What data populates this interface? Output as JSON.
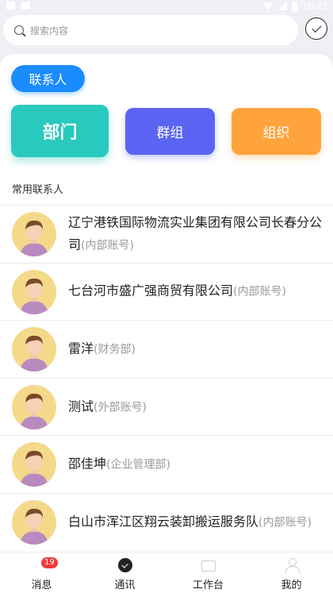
{
  "status_bar": {
    "time": "10:21"
  },
  "search": {
    "placeholder": "搜索内容"
  },
  "contacts_pill": "联系人",
  "categories": {
    "dept": "部门",
    "group": "群组",
    "org": "组织"
  },
  "section_title": "常用联系人",
  "contacts": [
    {
      "name": "辽宁港铁国际物流实业集团有限公司长春分公司",
      "tag": "(内部账号)"
    },
    {
      "name": "七台河市盛广强商贸有限公司",
      "tag": "(内部账号)"
    },
    {
      "name": "雷洋",
      "tag": "(财务部)"
    },
    {
      "name": "测试",
      "tag": "(外部账号)"
    },
    {
      "name": "邵佳坤",
      "tag": "(企业管理部)"
    },
    {
      "name": "白山市浑江区翔云装卸搬运服务队",
      "tag": "(内部账号)"
    }
  ],
  "tabs": [
    {
      "label": "消息",
      "badge": "19",
      "icon": "message-icon"
    },
    {
      "label": "通讯",
      "icon": "contacts-icon"
    },
    {
      "label": "工作台",
      "icon": "workbench-icon"
    },
    {
      "label": "我的",
      "icon": "profile-icon"
    }
  ]
}
